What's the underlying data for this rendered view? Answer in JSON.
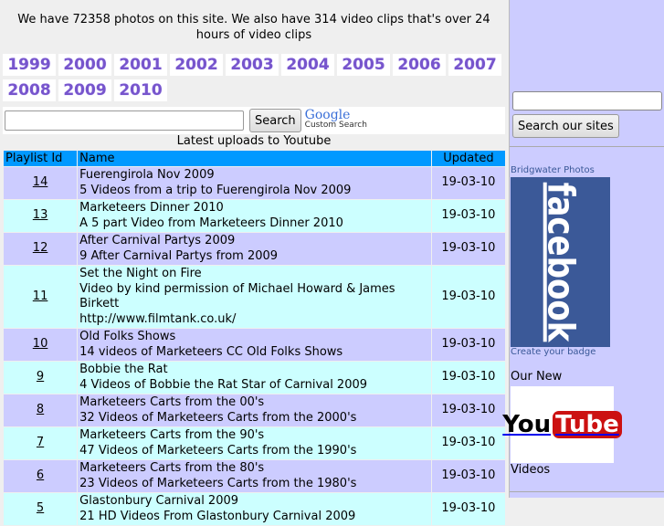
{
  "intro": "We have 72358 photos on this site. We also have 314 video clips that's over 24 hours of video clips",
  "years": [
    "1999",
    "2000",
    "2001",
    "2002",
    "2003",
    "2004",
    "2005",
    "2006",
    "2007",
    "2008",
    "2009",
    "2010"
  ],
  "search": {
    "value": "",
    "button": "Search",
    "logo": "Google",
    "logo_sub": "Custom Search"
  },
  "caption": "Latest uploads to Youtube",
  "table": {
    "headers": [
      "Playlist Id",
      "Name",
      "Updated"
    ],
    "rows": [
      {
        "id": "14",
        "title": "Fuerengirola Nov 2009",
        "desc": [
          "5 Videos from a trip to Fuerengirola Nov 2009"
        ],
        "updated": "19-03-10"
      },
      {
        "id": "13",
        "title": "Marketeers Dinner 2010",
        "desc": [
          "A 5 part Video from Marketeers Dinner 2010"
        ],
        "updated": "19-03-10"
      },
      {
        "id": "12",
        "title": "After Carnival Partys 2009",
        "desc": [
          "9 After Carnival Partys from 2009"
        ],
        "updated": "19-03-10"
      },
      {
        "id": "11",
        "title": "Set the Night on Fire",
        "desc": [
          "Video by kind permission of Michael Howard & James Birkett",
          "http://www.filmtank.co.uk/"
        ],
        "updated": "19-03-10"
      },
      {
        "id": "10",
        "title": "Old Folks Shows",
        "desc": [
          "14 videos of Marketeers CC Old Folks Shows"
        ],
        "updated": "19-03-10"
      },
      {
        "id": "9",
        "title": "Bobbie the Rat",
        "desc": [
          "4 Videos of Bobbie the Rat Star of Carnival 2009"
        ],
        "updated": "19-03-10"
      },
      {
        "id": "8",
        "title": "Marketeers Carts from the 00's",
        "desc": [
          "32 Videos of Marketeers Carts from the 2000's"
        ],
        "updated": "19-03-10"
      },
      {
        "id": "7",
        "title": "Marketeers Carts from the 90's",
        "desc": [
          "47 Videos of Marketeers Carts from the 1990's"
        ],
        "updated": "19-03-10"
      },
      {
        "id": "6",
        "title": "Marketeers Carts from the 80's",
        "desc": [
          "23 Videos of Marketeers Carts from the 1980's"
        ],
        "updated": "19-03-10"
      },
      {
        "id": "5",
        "title": "Glastonbury Carnival 2009",
        "desc": [
          "21 HD Videos From Glastonbury Carnival 2009"
        ],
        "updated": "19-03-10"
      }
    ]
  },
  "sidebar": {
    "search_value": "",
    "search_button": "Search our sites",
    "badge_title": "Bridgwater Photos",
    "badge_logo": "facebook",
    "badge_link": "Create your badge",
    "our_new": "Our New",
    "yt_you": "You",
    "yt_tube": "Tube",
    "videos": "Videos"
  }
}
